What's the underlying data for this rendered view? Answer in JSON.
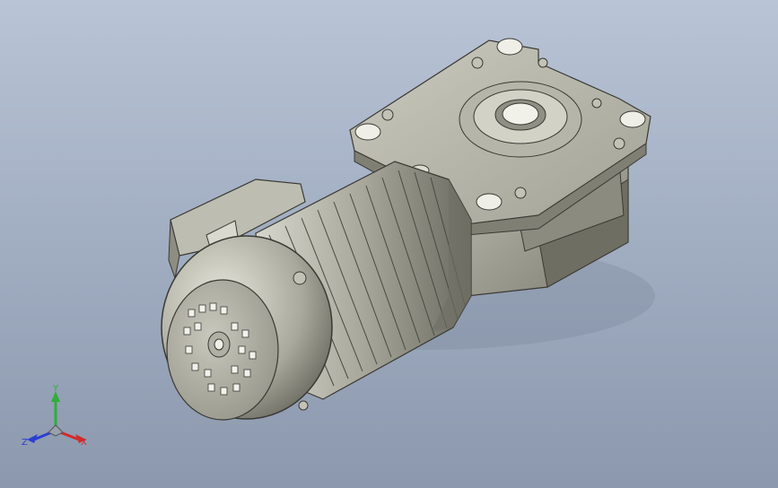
{
  "viewport": {
    "background_top": "#b9c4d6",
    "background_bottom": "#8c98ad"
  },
  "model": {
    "name": "gear motor",
    "body_color": "#9c9c8f",
    "shadow_color": "#55554e",
    "highlight_color": "#d9d9cf"
  },
  "triad": {
    "x_label": "X",
    "y_label": "Y",
    "z_label": "Z",
    "x_color": "#d12b2b",
    "y_color": "#2fae3a",
    "z_color": "#2b3fd1"
  }
}
